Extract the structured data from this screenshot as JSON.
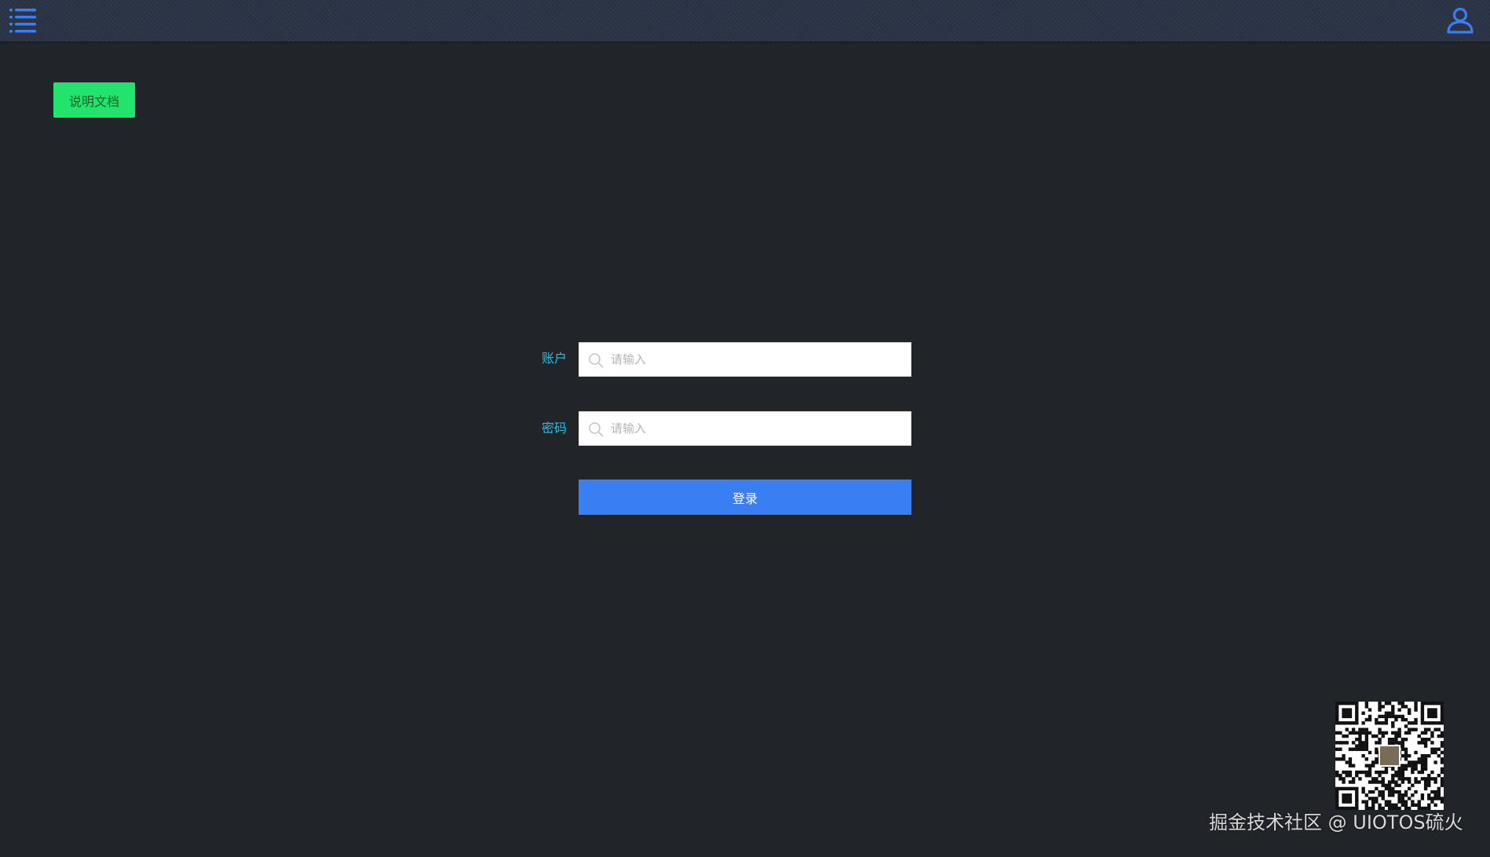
{
  "topbar": {
    "menu_icon": "hamburger-menu-icon",
    "user_icon": "user-icon",
    "accent_color": "#3a7ef3"
  },
  "doc_button": {
    "label": "说明文档",
    "color": "#22e36c"
  },
  "login_form": {
    "account": {
      "label": "账户",
      "placeholder": "请输入",
      "value": "",
      "icon": "search-icon"
    },
    "password": {
      "label": "密码",
      "placeholder": "请输入",
      "value": "",
      "icon": "search-icon"
    },
    "submit_label": "登录",
    "label_color": "#21c2ea",
    "submit_color": "#3a7ef3"
  },
  "qr_code": {
    "icon": "qr-code"
  },
  "watermark": {
    "text": "掘金技术社区 @ UIOTOS硫火"
  }
}
